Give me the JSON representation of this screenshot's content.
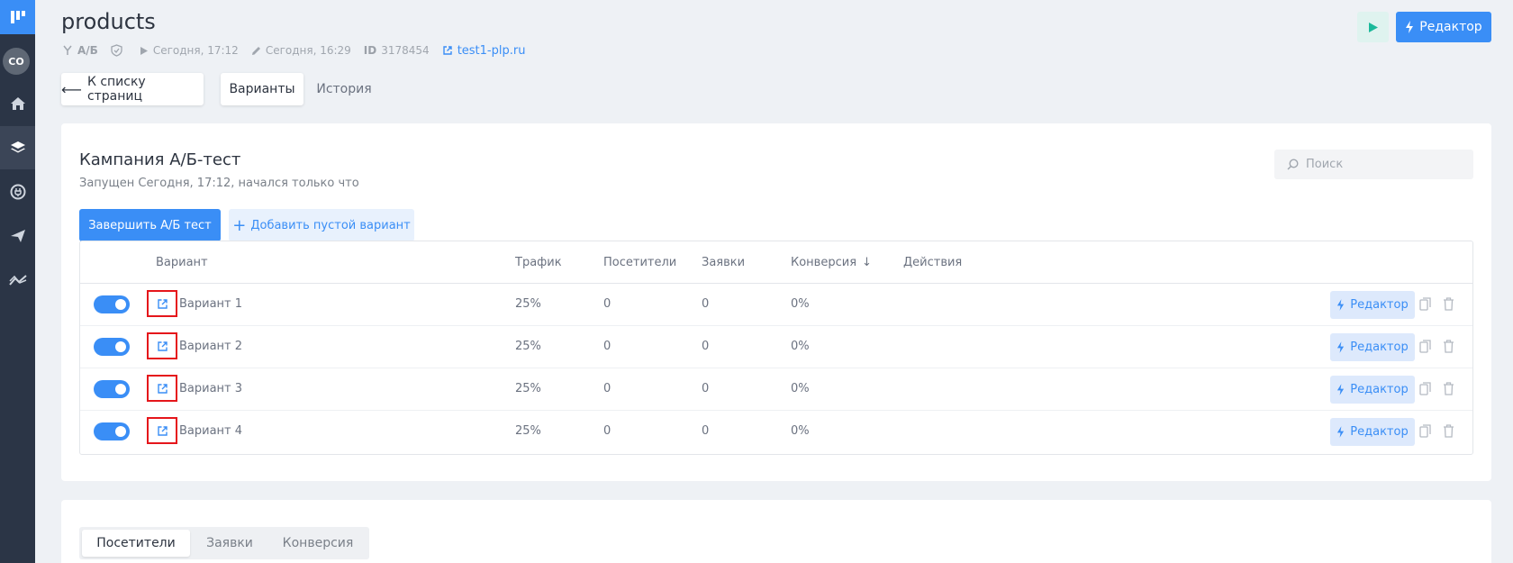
{
  "colors": {
    "accent": "#3a8ef6",
    "sidebar": "#2b3546",
    "highlight": "#e5161b"
  },
  "sidebar": {
    "avatar": "CO",
    "items": [
      {
        "name": "home",
        "icon": "home-icon"
      },
      {
        "name": "pages",
        "icon": "layers-icon"
      },
      {
        "name": "integrations",
        "icon": "plug-icon"
      },
      {
        "name": "send",
        "icon": "send-icon"
      },
      {
        "name": "analytics",
        "icon": "trend-icon"
      }
    ]
  },
  "header": {
    "title": "products",
    "ab_label": "А/Б",
    "published": "Сегодня, 17:12",
    "edited": "Сегодня, 16:29",
    "id_label": "ID",
    "id_value": "3178454",
    "domain": "test1-plp.ru",
    "editor_label": "Редактор"
  },
  "nav": {
    "back_label": "К списку страниц",
    "tab_variants": "Варианты",
    "tab_history": "История"
  },
  "campaign": {
    "title": "Кампания А/Б-тест",
    "subtitle": "Запущен Сегодня, 17:12, начался только что",
    "search_placeholder": "Поиск",
    "finish_label": "Завершить А/Б тест",
    "add_label": "Добавить пустой вариант"
  },
  "table": {
    "columns": {
      "variant": "Вариант",
      "traffic": "Трафик",
      "visitors": "Посетители",
      "leads": "Заявки",
      "conversion": "Конверсия",
      "actions": "Действия"
    },
    "editor_label": "Редактор",
    "rows": [
      {
        "name": "Вариант 1",
        "traffic": "25%",
        "visitors": "0",
        "leads": "0",
        "conversion": "0%",
        "enabled": true
      },
      {
        "name": "Вариант 2",
        "traffic": "25%",
        "visitors": "0",
        "leads": "0",
        "conversion": "0%",
        "enabled": true
      },
      {
        "name": "Вариант 3",
        "traffic": "25%",
        "visitors": "0",
        "leads": "0",
        "conversion": "0%",
        "enabled": true
      },
      {
        "name": "Вариант 4",
        "traffic": "25%",
        "visitors": "0",
        "leads": "0",
        "conversion": "0%",
        "enabled": true
      }
    ]
  },
  "stats": {
    "tabs": [
      "Посетители",
      "Заявки",
      "Конверсия"
    ]
  }
}
